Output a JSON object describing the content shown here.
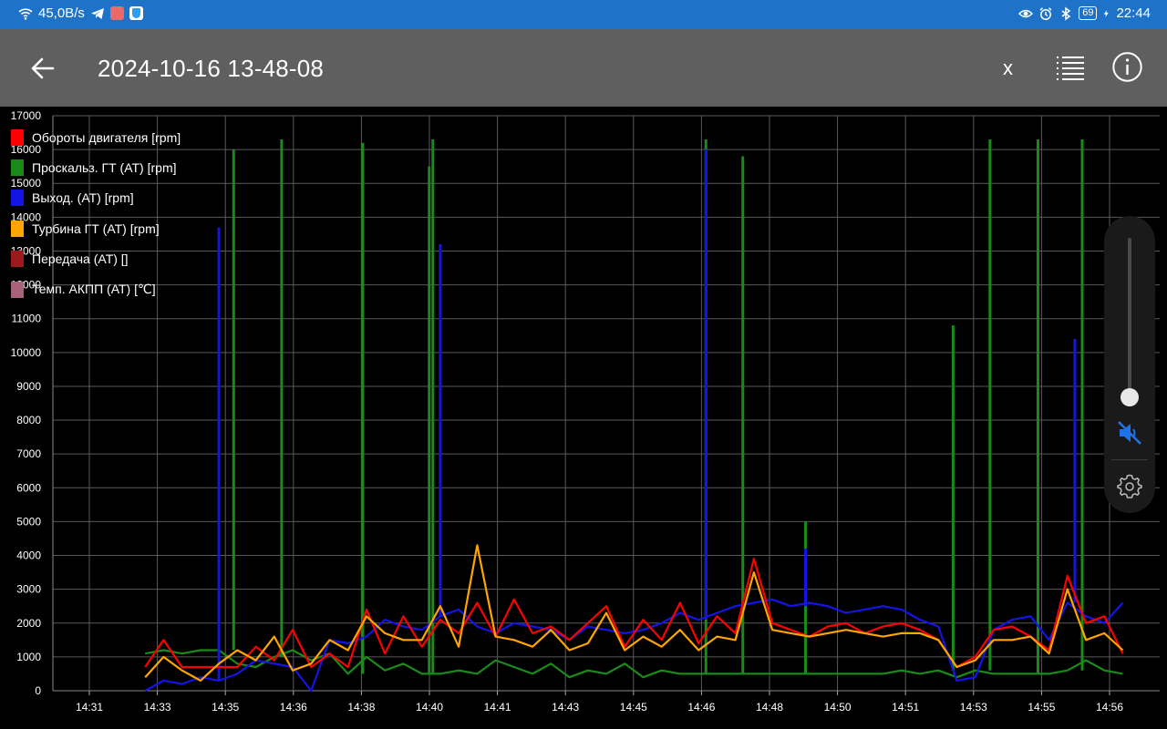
{
  "status_bar": {
    "net_speed": "45,0B/s",
    "battery": "69",
    "time": "22:44",
    "colors": {
      "bg": "#1e73c9"
    }
  },
  "app_bar": {
    "title": "2024-10-16 13-48-08",
    "x_label": "x",
    "icons": [
      "back-arrow-icon",
      "list-icon",
      "info-icon"
    ]
  },
  "chart_data": {
    "type": "line",
    "ylim": [
      0,
      17000
    ],
    "yticks": [
      0,
      1000,
      2000,
      3000,
      4000,
      5000,
      6000,
      7000,
      8000,
      9000,
      10000,
      11000,
      12000,
      13000,
      14000,
      15000,
      16000,
      17000
    ],
    "ytick_labels": [
      "0",
      "1000",
      "2000",
      "3000",
      "4000",
      "5000",
      "6000",
      "7000",
      "8000",
      "9000",
      "10000",
      "11000",
      "12000",
      "13000",
      "14000",
      "15000",
      "16000",
      "17000"
    ],
    "xtick_labels": [
      "14:31",
      "14:33",
      "14:35",
      "14:36",
      "14:38",
      "14:40",
      "14:41",
      "14:43",
      "14:45",
      "14:46",
      "14:48",
      "14:50",
      "14:51",
      "14:53",
      "14:55",
      "14:56"
    ],
    "xlim": [
      0,
      30
    ],
    "grid": true,
    "legend_position": "top-left",
    "series": [
      {
        "name": "Обороты двигателя [rpm]",
        "color": "#ff0000",
        "x": [
          2.5,
          3,
          3.5,
          4,
          4.5,
          5,
          5.5,
          6,
          6.5,
          7,
          7.5,
          8,
          8.5,
          9,
          9.5,
          10,
          10.5,
          11,
          11.5,
          12,
          12.5,
          13,
          13.5,
          14,
          14.5,
          15,
          15.5,
          16,
          16.5,
          17,
          17.5,
          18,
          18.5,
          19,
          19.5,
          20,
          20.5,
          21,
          21.5,
          22,
          22.5,
          23,
          23.5,
          24,
          24.5,
          25,
          25.5,
          26,
          26.5,
          27,
          27.5,
          28,
          28.5,
          29
        ],
        "y": [
          700,
          1500,
          700,
          700,
          700,
          700,
          1300,
          900,
          1800,
          700,
          1100,
          700,
          2400,
          1100,
          2200,
          1300,
          2100,
          1700,
          2600,
          1600,
          2700,
          1700,
          1900,
          1500,
          2000,
          2500,
          1300,
          2100,
          1500,
          2600,
          1400,
          2200,
          1700,
          3900,
          2000,
          1800,
          1600,
          1900,
          2000,
          1700,
          1900,
          2000,
          1800,
          1500,
          700,
          1000,
          1800,
          1900,
          1600,
          1200,
          3400,
          2000,
          2200,
          1100
        ]
      },
      {
        "name": "Проскальз. ГТ (AT) [rpm]",
        "color": "#1a8a1a",
        "x": [
          2.5,
          3,
          3.5,
          4,
          4.5,
          5,
          5.5,
          6,
          6.5,
          7,
          7.5,
          8,
          8.5,
          9,
          9.5,
          10,
          10.5,
          11,
          11.5,
          12,
          12.5,
          13,
          13.5,
          14,
          14.5,
          15,
          15.5,
          16,
          16.5,
          17,
          17.5,
          18,
          18.5,
          19,
          19.5,
          20,
          20.5,
          21,
          21.5,
          22,
          22.5,
          23,
          23.5,
          24,
          24.5,
          25,
          25.5,
          26,
          26.5,
          27,
          27.5,
          28,
          28.5,
          29
        ],
        "y": [
          1100,
          1200,
          1100,
          1200,
          1200,
          800,
          700,
          1000,
          1200,
          900,
          1100,
          500,
          1000,
          600,
          800,
          500,
          500,
          600,
          500,
          900,
          700,
          500,
          800,
          400,
          600,
          500,
          800,
          400,
          600,
          500,
          500,
          500,
          500,
          500,
          500,
          500,
          500,
          500,
          500,
          500,
          500,
          600,
          500,
          600,
          400,
          600,
          500,
          500,
          500,
          500,
          600,
          900,
          600,
          500
        ]
      },
      {
        "name": "Выход. (AT) [rpm]",
        "color": "#1414e6",
        "x": [
          2.5,
          3,
          3.5,
          4,
          4.5,
          5,
          5.5,
          6,
          6.5,
          7,
          7.5,
          8,
          8.5,
          9,
          9.5,
          10,
          10.5,
          11,
          11.5,
          12,
          12.5,
          13,
          13.5,
          14,
          14.5,
          15,
          15.5,
          16,
          16.5,
          17,
          17.5,
          18,
          18.5,
          19,
          19.5,
          20,
          20.5,
          21,
          21.5,
          22,
          22.5,
          23,
          23.5,
          24,
          24.5,
          25,
          25.5,
          26,
          26.5,
          27,
          27.5,
          28,
          28.5,
          29
        ],
        "y": [
          0,
          300,
          200,
          400,
          300,
          500,
          900,
          800,
          700,
          0,
          1500,
          1400,
          1600,
          2100,
          1900,
          1800,
          2200,
          2400,
          1900,
          1700,
          2000,
          1900,
          1800,
          1500,
          1900,
          1800,
          1700,
          1800,
          2000,
          2300,
          2100,
          2300,
          2500,
          2600,
          2700,
          2500,
          2600,
          2500,
          2300,
          2400,
          2500,
          2400,
          2100,
          1900,
          300,
          400,
          1800,
          2100,
          2200,
          1500,
          2600,
          2200,
          2000,
          2600
        ]
      },
      {
        "name": "Турбина ГТ (AT) [rpm]",
        "color": "#ffa500",
        "x": [
          2.5,
          3,
          3.5,
          4,
          4.5,
          5,
          5.5,
          6,
          6.5,
          7,
          7.5,
          8,
          8.5,
          9,
          9.5,
          10,
          10.5,
          11,
          11.5,
          12,
          12.5,
          13,
          13.5,
          14,
          14.5,
          15,
          15.5,
          16,
          16.5,
          17,
          17.5,
          18,
          18.5,
          19,
          19.5,
          20,
          20.5,
          21,
          21.5,
          22,
          22.5,
          23,
          23.5,
          24,
          24.5,
          25,
          25.5,
          26,
          26.5,
          27,
          27.5,
          28,
          28.5,
          29
        ],
        "y": [
          400,
          1000,
          600,
          300,
          800,
          1200,
          900,
          1600,
          600,
          800,
          1500,
          1200,
          2200,
          1700,
          1500,
          1500,
          2500,
          1300,
          4300,
          1600,
          1500,
          1300,
          1800,
          1200,
          1400,
          2300,
          1200,
          1600,
          1300,
          1800,
          1200,
          1600,
          1500,
          3500,
          1800,
          1700,
          1600,
          1700,
          1800,
          1700,
          1600,
          1700,
          1700,
          1500,
          700,
          900,
          1500,
          1500,
          1600,
          1100,
          3000,
          1500,
          1700,
          1200
        ]
      },
      {
        "name": "Передача (AT) []",
        "color": "#9b1b1b",
        "x": [],
        "y": []
      },
      {
        "name": "Темп. АКПП (AT) [℃]",
        "color": "#a8627a",
        "x": [],
        "y": []
      }
    ],
    "spikes": [
      {
        "series": 1,
        "x": 4.9,
        "y": 16000
      },
      {
        "series": 1,
        "x": 6.2,
        "y": 16300
      },
      {
        "series": 1,
        "x": 8.4,
        "y": 16200
      },
      {
        "series": 1,
        "x": 10.2,
        "y": 15500
      },
      {
        "series": 1,
        "x": 10.3,
        "y": 16300
      },
      {
        "series": 1,
        "x": 17.7,
        "y": 16300
      },
      {
        "series": 1,
        "x": 18.7,
        "y": 15800
      },
      {
        "series": 1,
        "x": 20.4,
        "y": 5000
      },
      {
        "series": 1,
        "x": 24.4,
        "y": 10800
      },
      {
        "series": 1,
        "x": 25.4,
        "y": 16300
      },
      {
        "series": 1,
        "x": 26.7,
        "y": 16300
      },
      {
        "series": 1,
        "x": 27.9,
        "y": 16300
      },
      {
        "series": 2,
        "x": 4.5,
        "y": 13700
      },
      {
        "series": 2,
        "x": 10.5,
        "y": 13200
      },
      {
        "series": 2,
        "x": 17.7,
        "y": 16000
      },
      {
        "series": 2,
        "x": 20.4,
        "y": 4200
      },
      {
        "series": 2,
        "x": 27.7,
        "y": 10400
      }
    ]
  },
  "volume_panel": {
    "level": 0,
    "muted": true,
    "icons": [
      "mute-icon",
      "settings-icon"
    ]
  }
}
